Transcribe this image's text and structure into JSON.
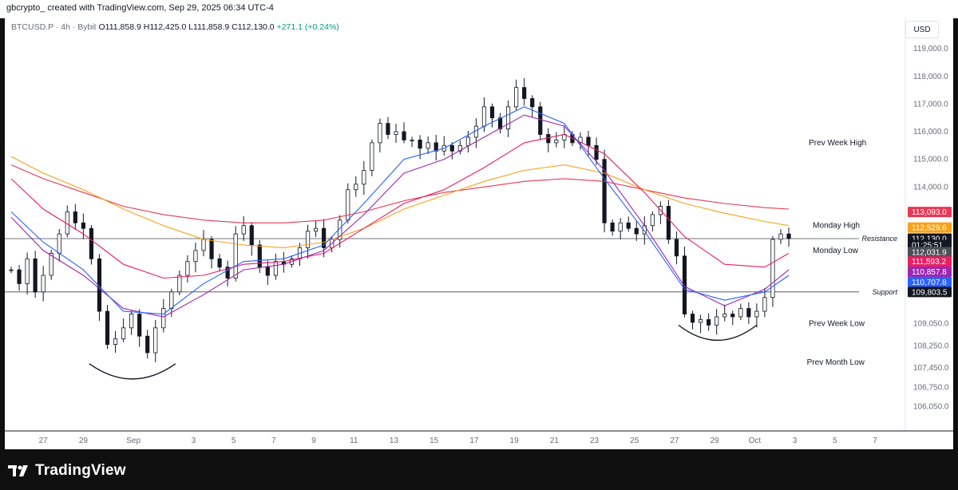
{
  "header": {
    "author_line": "gbcrypto_ created with TradingView.com, Sep 29, 2025 06:34 UTC-4"
  },
  "legend": {
    "symbol": "BTCUSD.P · 4h · Bybit",
    "open": "O111,858.9",
    "high": "H112,425.0",
    "low": "L111,858.9",
    "close": "C112,130.0",
    "change": "+271.1 (+0.24%)"
  },
  "currency": "USD",
  "footer": {
    "logo_text": "TradingView",
    "logo_icon": "tradingview-logo-icon"
  },
  "chart_data": {
    "type": "candlestick",
    "ylim": [
      105400,
      119900
    ],
    "price_ticks": [
      "119,000.0",
      "118,000.0",
      "117,000.0",
      "116,000.0",
      "115,000.0",
      "114,000.0",
      "109,050.0",
      "108,250.0",
      "107,450.0",
      "106,750.0",
      "106,050.0"
    ],
    "price_tick_values": [
      119000,
      118000,
      117000,
      116000,
      115000,
      114000,
      109050,
      108250,
      107450,
      106750,
      106050
    ],
    "time_ticks": [
      {
        "label": "27",
        "t": 0
      },
      {
        "label": "29",
        "t": 2
      },
      {
        "label": "Sep",
        "t": 4.5
      },
      {
        "label": "3",
        "t": 7.5
      },
      {
        "label": "5",
        "t": 9.5
      },
      {
        "label": "7",
        "t": 11.5
      },
      {
        "label": "9",
        "t": 13.5
      },
      {
        "label": "11",
        "t": 15.5
      },
      {
        "label": "13",
        "t": 17.5
      },
      {
        "label": "15",
        "t": 19.5
      },
      {
        "label": "17",
        "t": 21.5
      },
      {
        "label": "19",
        "t": 23.5
      },
      {
        "label": "21",
        "t": 25.5
      },
      {
        "label": "23",
        "t": 27.5
      },
      {
        "label": "25",
        "t": 29.5
      },
      {
        "label": "27",
        "t": 31.5
      },
      {
        "label": "29",
        "t": 33.5
      },
      {
        "label": "Oct",
        "t": 35.5
      },
      {
        "label": "3",
        "t": 37.5
      },
      {
        "label": "5",
        "t": 39.5
      },
      {
        "label": "7",
        "t": 41.5
      }
    ],
    "close_path": [
      [
        -1.6,
        111000
      ],
      [
        -1.2,
        110500
      ],
      [
        -0.8,
        111400
      ],
      [
        -0.4,
        110200
      ],
      [
        0,
        110800
      ],
      [
        0.4,
        111600
      ],
      [
        0.8,
        112300
      ],
      [
        1.2,
        113100
      ],
      [
        1.6,
        112700
      ],
      [
        2,
        112500
      ],
      [
        2.4,
        111400
      ],
      [
        2.8,
        109500
      ],
      [
        3.2,
        108300
      ],
      [
        3.6,
        108500
      ],
      [
        4,
        108900
      ],
      [
        4.4,
        109400
      ],
      [
        4.8,
        108600
      ],
      [
        5.2,
        108000
      ],
      [
        5.6,
        108900
      ],
      [
        6,
        109600
      ],
      [
        6.4,
        110200
      ],
      [
        6.8,
        110800
      ],
      [
        7.2,
        111300
      ],
      [
        7.6,
        111700
      ],
      [
        8,
        112100
      ],
      [
        8.4,
        111400
      ],
      [
        8.8,
        111100
      ],
      [
        9.2,
        110700
      ],
      [
        9.6,
        112300
      ],
      [
        10,
        112600
      ],
      [
        10.4,
        111900
      ],
      [
        10.8,
        111100
      ],
      [
        11.2,
        110800
      ],
      [
        11.6,
        111300
      ],
      [
        12,
        111200
      ],
      [
        12.4,
        111400
      ],
      [
        12.8,
        111800
      ],
      [
        13.2,
        112400
      ],
      [
        13.6,
        112500
      ],
      [
        14,
        111800
      ],
      [
        14.4,
        112100
      ],
      [
        14.8,
        112800
      ],
      [
        15.2,
        113900
      ],
      [
        15.6,
        114100
      ],
      [
        16,
        114600
      ],
      [
        16.4,
        115600
      ],
      [
        16.8,
        116300
      ],
      [
        17.2,
        115900
      ],
      [
        17.6,
        116000
      ],
      [
        18,
        115700
      ],
      [
        18.4,
        115700
      ],
      [
        18.8,
        115400
      ],
      [
        19.2,
        115600
      ],
      [
        19.6,
        115300
      ],
      [
        20,
        115500
      ],
      [
        20.4,
        115300
      ],
      [
        20.8,
        115500
      ],
      [
        21.2,
        115800
      ],
      [
        21.6,
        116200
      ],
      [
        22,
        116900
      ],
      [
        22.4,
        116500
      ],
      [
        22.8,
        116100
      ],
      [
        23.2,
        116900
      ],
      [
        23.6,
        117600
      ],
      [
        24,
        117200
      ],
      [
        24.4,
        116900
      ],
      [
        24.8,
        115900
      ],
      [
        25.2,
        115600
      ],
      [
        25.6,
        115700
      ],
      [
        26,
        115900
      ],
      [
        26.4,
        115600
      ],
      [
        26.8,
        115800
      ],
      [
        27.2,
        115500
      ],
      [
        27.6,
        115000
      ],
      [
        28,
        112700
      ],
      [
        28.4,
        112400
      ],
      [
        28.8,
        112700
      ],
      [
        29.2,
        112500
      ],
      [
        29.6,
        112300
      ],
      [
        30,
        112600
      ],
      [
        30.4,
        113000
      ],
      [
        30.8,
        113300
      ],
      [
        31.2,
        112100
      ],
      [
        31.6,
        111500
      ],
      [
        32,
        109400
      ],
      [
        32.4,
        109100
      ],
      [
        32.8,
        109200
      ],
      [
        33.2,
        109000
      ],
      [
        33.6,
        109300
      ],
      [
        34,
        109400
      ],
      [
        34.4,
        109300
      ],
      [
        34.8,
        109600
      ],
      [
        35.2,
        109300
      ],
      [
        35.6,
        109500
      ],
      [
        36,
        110000
      ],
      [
        36.4,
        112100
      ],
      [
        36.8,
        112300
      ],
      [
        37.2,
        112130
      ]
    ],
    "series": [
      {
        "name": "",
        "color": "#e53956",
        "points": [
          [
            -1.6,
            114800
          ],
          [
            0,
            114300
          ],
          [
            2,
            113800
          ],
          [
            4,
            113300
          ],
          [
            6,
            113000
          ],
          [
            8,
            112800
          ],
          [
            10,
            112700
          ],
          [
            12,
            112700
          ],
          [
            14,
            112800
          ],
          [
            16,
            113100
          ],
          [
            18,
            113500
          ],
          [
            20,
            113800
          ],
          [
            22,
            114000
          ],
          [
            24,
            114200
          ],
          [
            26,
            114300
          ],
          [
            28,
            114200
          ],
          [
            30,
            113900
          ],
          [
            32,
            113600
          ],
          [
            34,
            113400
          ],
          [
            36,
            113250
          ],
          [
            37.2,
            113200
          ]
        ]
      },
      {
        "name": "",
        "color": "#f7a21b",
        "points": [
          [
            -1.6,
            115100
          ],
          [
            0,
            114500
          ],
          [
            2,
            113900
          ],
          [
            4,
            113200
          ],
          [
            6,
            112600
          ],
          [
            8,
            112100
          ],
          [
            10,
            111900
          ],
          [
            12,
            111800
          ],
          [
            14,
            112000
          ],
          [
            16,
            112500
          ],
          [
            18,
            113200
          ],
          [
            20,
            113700
          ],
          [
            22,
            114200
          ],
          [
            24,
            114600
          ],
          [
            26,
            114800
          ],
          [
            28,
            114500
          ],
          [
            30,
            113900
          ],
          [
            32,
            113400
          ],
          [
            34,
            113050
          ],
          [
            36,
            112750
          ],
          [
            37.2,
            112600
          ]
        ]
      },
      {
        "name": "",
        "color": "#e91e63",
        "points": [
          [
            -1.6,
            114300
          ],
          [
            0,
            113200
          ],
          [
            2,
            112300
          ],
          [
            4,
            111200
          ],
          [
            6,
            110700
          ],
          [
            8,
            110800
          ],
          [
            10,
            111200
          ],
          [
            12,
            111300
          ],
          [
            14,
            111600
          ],
          [
            16,
            112500
          ],
          [
            18,
            113400
          ],
          [
            20,
            113900
          ],
          [
            22,
            114700
          ],
          [
            24,
            115600
          ],
          [
            26,
            115900
          ],
          [
            28,
            115200
          ],
          [
            30,
            113800
          ],
          [
            32,
            112200
          ],
          [
            34,
            111200
          ],
          [
            36,
            111100
          ],
          [
            37.2,
            111600
          ]
        ]
      },
      {
        "name": "",
        "color": "#9c27b0",
        "points": [
          [
            -1.6,
            112900
          ],
          [
            0,
            111700
          ],
          [
            2,
            110800
          ],
          [
            4,
            109600
          ],
          [
            6,
            109300
          ],
          [
            8,
            110100
          ],
          [
            10,
            111000
          ],
          [
            12,
            111200
          ],
          [
            14,
            111700
          ],
          [
            16,
            113000
          ],
          [
            18,
            114500
          ],
          [
            20,
            115000
          ],
          [
            22,
            115800
          ],
          [
            24,
            116600
          ],
          [
            26,
            116200
          ],
          [
            28,
            114600
          ],
          [
            30,
            112600
          ],
          [
            32,
            110400
          ],
          [
            34,
            109700
          ],
          [
            36,
            110300
          ],
          [
            37.2,
            111000
          ]
        ]
      },
      {
        "name": "",
        "color": "#2962ff",
        "points": [
          [
            -1.6,
            113100
          ],
          [
            0,
            112000
          ],
          [
            2,
            111000
          ],
          [
            4,
            109500
          ],
          [
            6,
            109400
          ],
          [
            8,
            110500
          ],
          [
            10,
            111300
          ],
          [
            12,
            111400
          ],
          [
            14,
            111900
          ],
          [
            16,
            113400
          ],
          [
            18,
            115000
          ],
          [
            20,
            115400
          ],
          [
            22,
            116200
          ],
          [
            24,
            116900
          ],
          [
            26,
            116300
          ],
          [
            28,
            114300
          ],
          [
            30,
            112400
          ],
          [
            32,
            110300
          ],
          [
            34,
            109900
          ],
          [
            36,
            110200
          ],
          [
            37.2,
            110800
          ]
        ]
      }
    ],
    "right_axis_badges": [
      {
        "text": "113,093.0",
        "value": 113093.0,
        "color": "#e53956"
      },
      {
        "text": "112,529.6",
        "value": 112529.6,
        "color": "#f7a21b"
      },
      {
        "text": "112,130.0",
        "value": 112130.0,
        "color": "#131722"
      },
      {
        "text": "01:25:51",
        "value": 111900,
        "color": "#131722"
      },
      {
        "text": "112,031.9",
        "value": 111640,
        "color": "#4d4f57"
      },
      {
        "text": "111,593.2",
        "value": 111300,
        "color": "#e91e63"
      },
      {
        "text": "110,857.8",
        "value": 110930,
        "color": "#9c27b0"
      },
      {
        "text": "110,707.8",
        "value": 110560,
        "color": "#2962ff"
      },
      {
        "text": "109,803.5",
        "value": 110200,
        "color": "#131722"
      }
    ],
    "horizontal_levels": [
      {
        "label": "Resistance",
        "value": 112130
      },
      {
        "label": "Support",
        "value": 110200
      }
    ],
    "annotations": [
      {
        "text": "Prev Week High",
        "value": 115600,
        "t": 38.2
      },
      {
        "text": "Monday High",
        "value": 112600,
        "t": 38.4
      },
      {
        "text": "Monday Low",
        "value": 111700,
        "t": 38.4
      },
      {
        "text": "Prev Week Low",
        "value": 109050,
        "t": 38.2
      },
      {
        "text": "Prev Month Low",
        "value": 107650,
        "t": 38.1
      }
    ],
    "arcs": [
      {
        "t_start": 2.3,
        "t_end": 6.6,
        "value_top": 107600,
        "value_bottom": 107050
      },
      {
        "t_start": 31.7,
        "t_end": 35.6,
        "value_top": 109000,
        "value_bottom": 108450
      }
    ]
  }
}
